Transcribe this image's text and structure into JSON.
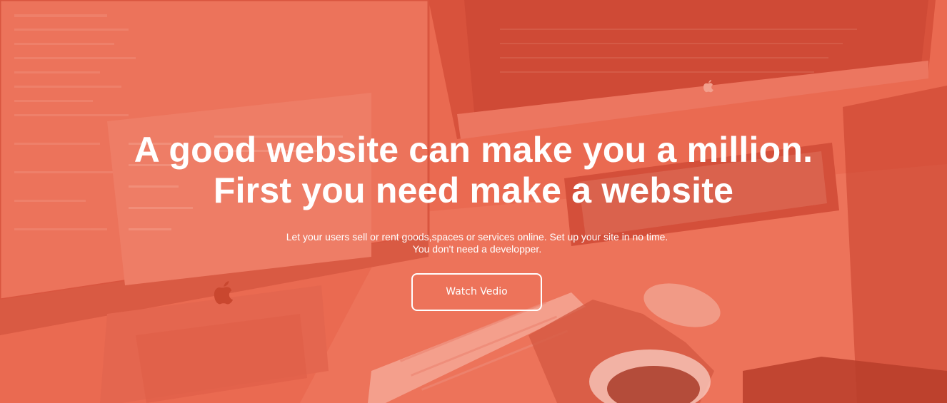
{
  "hero": {
    "headline_line1": "A good website can make you a million.",
    "headline_line2": "First you need make a website",
    "subtext_line1": "Let your users sell or rent goods,spaces or services online. Set up your site in no time.",
    "subtext_line2": "You don't need a developper.",
    "cta_label": "Watch Vedio",
    "overlay_color": "#ea6a51",
    "text_color": "#ffffff"
  },
  "background": {
    "icons": [
      "apple-logo-icon",
      "apple-logo-icon"
    ]
  }
}
